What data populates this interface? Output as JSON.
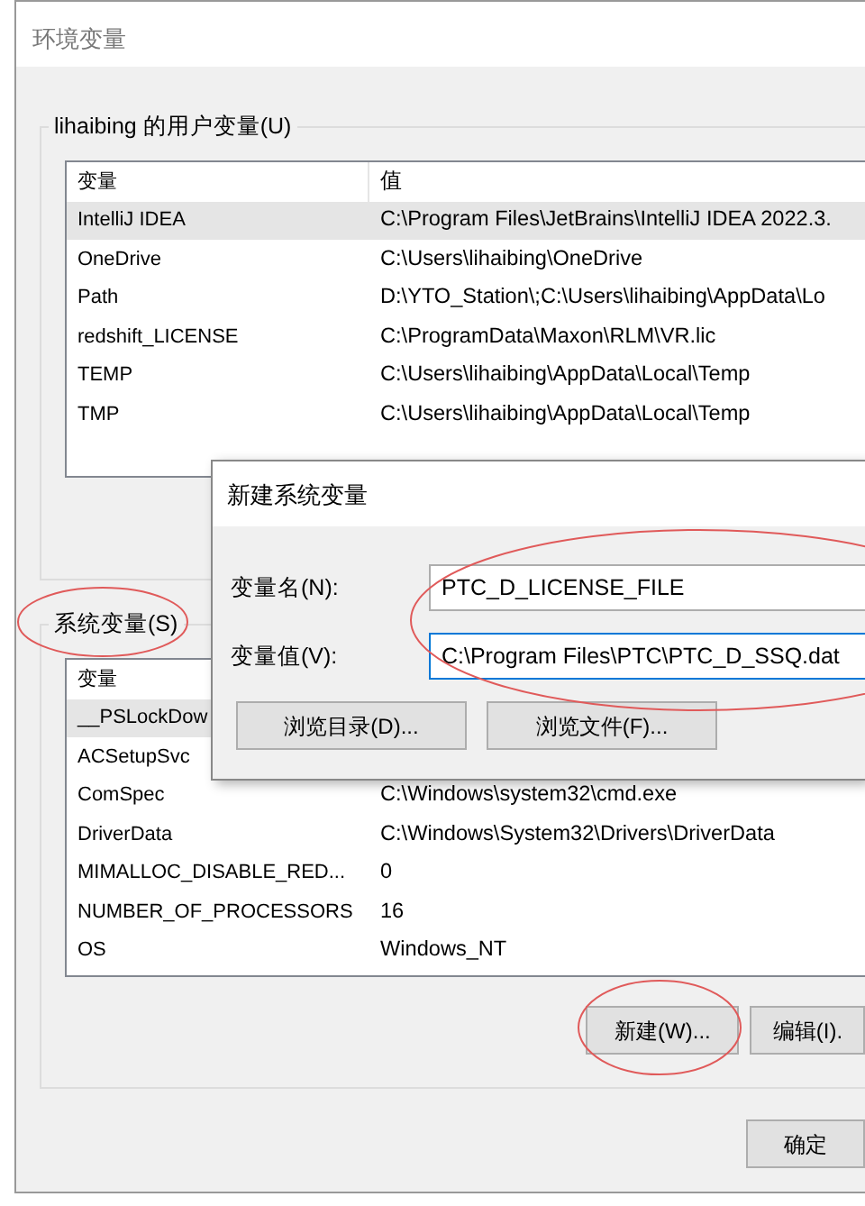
{
  "window": {
    "title": "环境变量"
  },
  "user_variables": {
    "label": "lihaibing 的用户变量(U)",
    "columns": [
      "变量",
      "值"
    ],
    "rows": [
      {
        "name": "IntelliJ IDEA",
        "value": "C:\\Program Files\\JetBrains\\IntelliJ IDEA 2022.3.",
        "selected": true
      },
      {
        "name": "OneDrive",
        "value": "C:\\Users\\lihaibing\\OneDrive",
        "selected": false
      },
      {
        "name": "Path",
        "value": "D:\\YTO_Station\\;C:\\Users\\lihaibing\\AppData\\Lo",
        "selected": false
      },
      {
        "name": "redshift_LICENSE",
        "value": "C:\\ProgramData\\Maxon\\RLM\\VR.lic",
        "selected": false
      },
      {
        "name": "TEMP",
        "value": "C:\\Users\\lihaibing\\AppData\\Local\\Temp",
        "selected": false
      },
      {
        "name": "TMP",
        "value": "C:\\Users\\lihaibing\\AppData\\Local\\Temp",
        "selected": false
      }
    ]
  },
  "system_variables": {
    "label": "系统变量(S)",
    "columns": [
      "变量"
    ],
    "rows": [
      {
        "name": "__PSLockDow",
        "selected": true
      },
      {
        "name": "ACSetupSvc",
        "selected": false
      },
      {
        "name": "ComSpec",
        "value": "C:\\Windows\\system32\\cmd.exe",
        "selected": false
      },
      {
        "name": "DriverData",
        "value": "C:\\Windows\\System32\\Drivers\\DriverData",
        "selected": false
      },
      {
        "name": "MIMALLOC_DISABLE_RED...",
        "value": "0",
        "selected": false
      },
      {
        "name": "NUMBER_OF_PROCESSORS",
        "value": "16",
        "selected": false
      },
      {
        "name": "OS",
        "value": "Windows_NT",
        "selected": false
      }
    ],
    "buttons": [
      "新建(W)...",
      "编辑(I)."
    ]
  },
  "footer_buttons": [
    "确定"
  ],
  "dialog": {
    "title": "新建系统变量",
    "fields": [
      {
        "label": "变量名(N):",
        "value": "PTC_D_LICENSE_FILE",
        "focused": false
      },
      {
        "label": "变量值(V):",
        "value": "C:\\Program Files\\PTC\\PTC_D_SSQ.dat",
        "focused": true
      }
    ],
    "buttons": [
      "浏览目录(D)...",
      "浏览文件(F)..."
    ]
  }
}
